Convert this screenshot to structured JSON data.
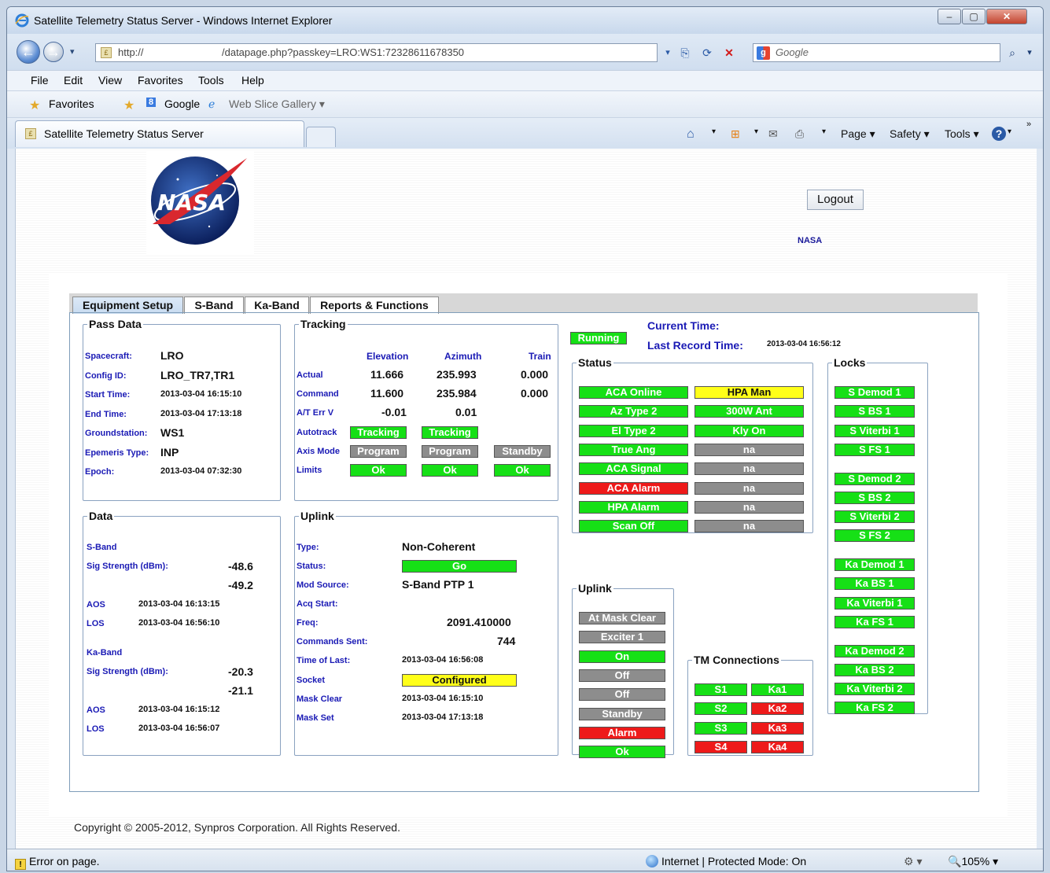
{
  "window": {
    "title": "Satellite Telemetry Status Server - Windows Internet Explorer"
  },
  "address": {
    "prefix": "http://",
    "url": "/datapage.php?passkey=LRO:WS1:72328611678350"
  },
  "search": {
    "placeholder": "Google"
  },
  "menu": [
    "File",
    "Edit",
    "View",
    "Favorites",
    "Tools",
    "Help"
  ],
  "favbar": {
    "favorites": "Favorites",
    "google": "Google",
    "slice": "Web Slice Gallery ▾"
  },
  "tab": {
    "title": "Satellite Telemetry Status Server"
  },
  "commandbar": {
    "page": "Page ▾",
    "safety": "Safety ▾",
    "tools": "Tools ▾"
  },
  "page": {
    "logout": "Logout",
    "nasa": "NASA",
    "copyright": "Copyright © 2005-2012, Synpros Corporation. All Rights Reserved."
  },
  "tabs": [
    "Equipment Setup",
    "S-Band",
    "Ka-Band",
    "Reports & Functions"
  ],
  "pass": {
    "legend": "Pass Data",
    "rows": [
      {
        "label": "Spacecraft:",
        "value": "LRO"
      },
      {
        "label": "Config ID:",
        "value": "LRO_TR7,TR1"
      },
      {
        "label": "Start Time:",
        "value": "2013-03-04 16:15:10"
      },
      {
        "label": "End Time:",
        "value": "2013-03-04 17:13:18"
      },
      {
        "label": "Groundstation:",
        "value": "WS1"
      },
      {
        "label": "Epemeris Type:",
        "value": "INP"
      },
      {
        "label": "Epoch:",
        "value": "2013-03-04 07:32:30"
      }
    ]
  },
  "tracking": {
    "legend": "Tracking",
    "cols": [
      "Elevation",
      "Azimuth",
      "Train"
    ],
    "actual": {
      "label": "Actual",
      "values": [
        "11.666",
        "235.993",
        "0.000"
      ]
    },
    "command": {
      "label": "Command",
      "values": [
        "11.600",
        "235.984",
        "0.000"
      ]
    },
    "aterr": {
      "label": "A/T Err V",
      "values": [
        "-0.01",
        "0.01"
      ]
    },
    "autotrack": {
      "label": "Autotrack",
      "values": [
        "Tracking",
        "Tracking"
      ]
    },
    "axis": {
      "label": "Axis Mode",
      "values": [
        "Program",
        "Program",
        "Standby"
      ]
    },
    "limits": {
      "label": "Limits",
      "values": [
        "Ok",
        "Ok",
        "Ok"
      ]
    }
  },
  "data": {
    "legend": "Data",
    "sband": "S-Band",
    "sig": "Sig Strength (dBm):",
    "s1": "-48.6",
    "s2": "-49.2",
    "aos": "AOS",
    "aos_s": "2013-03-04 16:13:15",
    "los": "LOS",
    "los_s": "2013-03-04 16:56:10",
    "kaband": "Ka-Band",
    "k1": "-20.3",
    "k2": "-21.1",
    "aos_k": "2013-03-04 16:15:12",
    "los_k": "2013-03-04 16:56:07"
  },
  "uplinkinfo": {
    "legend": "Uplink",
    "type_l": "Type:",
    "type_v": "Non-Coherent",
    "status_l": "Status:",
    "status_v": "Go",
    "mod_l": "Mod Source:",
    "mod_v": "S-Band PTP 1",
    "acq_l": "Acq Start:",
    "freq_l": "Freq:",
    "freq_v": "2091.410000",
    "cmds_l": "Commands Sent:",
    "cmds_v": "744",
    "last_l": "Time of Last:",
    "last_v": "2013-03-04 16:56:08",
    "sock_l": "Socket",
    "sock_v": "Configured",
    "mc_l": "Mask Clear",
    "mc_v": "2013-03-04 16:15:10",
    "ms_l": "Mask Set",
    "ms_v": "2013-03-04 17:13:18"
  },
  "running": "Running",
  "time": {
    "current": "Current Time:",
    "last": "Last Record Time:",
    "last_v": "2013-03-04 16:56:12"
  },
  "status": {
    "legend": "Status",
    "left": [
      {
        "t": "ACA Online",
        "c": "g"
      },
      {
        "t": "Az Type 2",
        "c": "g"
      },
      {
        "t": "El Type 2",
        "c": "g"
      },
      {
        "t": "True Ang",
        "c": "g"
      },
      {
        "t": "ACA Signal",
        "c": "g"
      },
      {
        "t": "ACA Alarm",
        "c": "r"
      },
      {
        "t": "HPA Alarm",
        "c": "g"
      },
      {
        "t": "Scan Off",
        "c": "g"
      }
    ],
    "right": [
      {
        "t": "HPA Man",
        "c": "y"
      },
      {
        "t": "300W Ant",
        "c": "g"
      },
      {
        "t": "Kly On",
        "c": "g"
      },
      {
        "t": "na",
        "c": "gy"
      },
      {
        "t": "na",
        "c": "gy"
      },
      {
        "t": "na",
        "c": "gy"
      },
      {
        "t": "na",
        "c": "gy"
      },
      {
        "t": "na",
        "c": "gy"
      }
    ]
  },
  "uplink2": {
    "legend": "Uplink",
    "items": [
      {
        "t": "At Mask Clear",
        "c": "gy"
      },
      {
        "t": "Exciter 1",
        "c": "gy"
      },
      {
        "t": "On",
        "c": "g"
      },
      {
        "t": "Off",
        "c": "gy"
      },
      {
        "t": "Off",
        "c": "gy"
      },
      {
        "t": "Standby",
        "c": "gy"
      },
      {
        "t": "Alarm",
        "c": "r"
      },
      {
        "t": "Ok",
        "c": "g"
      }
    ]
  },
  "tm": {
    "legend": "TM Connections",
    "left": [
      {
        "t": "S1",
        "c": "g"
      },
      {
        "t": "S2",
        "c": "g"
      },
      {
        "t": "S3",
        "c": "g"
      },
      {
        "t": "S4",
        "c": "r"
      }
    ],
    "right": [
      {
        "t": "Ka1",
        "c": "g"
      },
      {
        "t": "Ka2",
        "c": "r"
      },
      {
        "t": "Ka3",
        "c": "r"
      },
      {
        "t": "Ka4",
        "c": "r"
      }
    ]
  },
  "locks": {
    "legend": "Locks",
    "items": [
      {
        "t": "S Demod 1",
        "c": "g"
      },
      {
        "t": "S BS 1",
        "c": "g"
      },
      {
        "t": "S Viterbi 1",
        "c": "g"
      },
      {
        "t": "S FS 1",
        "c": "g"
      },
      {
        "t": "S Demod 2",
        "c": "g"
      },
      {
        "t": "S BS 2",
        "c": "g"
      },
      {
        "t": "S Viterbi 2",
        "c": "g"
      },
      {
        "t": "S FS 2",
        "c": "g"
      },
      {
        "t": "Ka Demod 1",
        "c": "g"
      },
      {
        "t": "Ka BS 1",
        "c": "g"
      },
      {
        "t": "Ka Viterbi 1",
        "c": "g"
      },
      {
        "t": "Ka FS 1",
        "c": "g"
      },
      {
        "t": "Ka Demod 2",
        "c": "g"
      },
      {
        "t": "Ka BS 2",
        "c": "g"
      },
      {
        "t": "Ka Viterbi 2",
        "c": "g"
      },
      {
        "t": "Ka FS 2",
        "c": "g"
      }
    ]
  },
  "statusbar": {
    "error": "Error on page.",
    "zone": "Internet | Protected Mode: On",
    "zoom": "105%"
  },
  "colors": {
    "green": "#16e016",
    "gray": "#8d8d8d",
    "red": "#ee1a1a",
    "yellow": "#ffff19",
    "label_blue": "#1a1ab5"
  }
}
